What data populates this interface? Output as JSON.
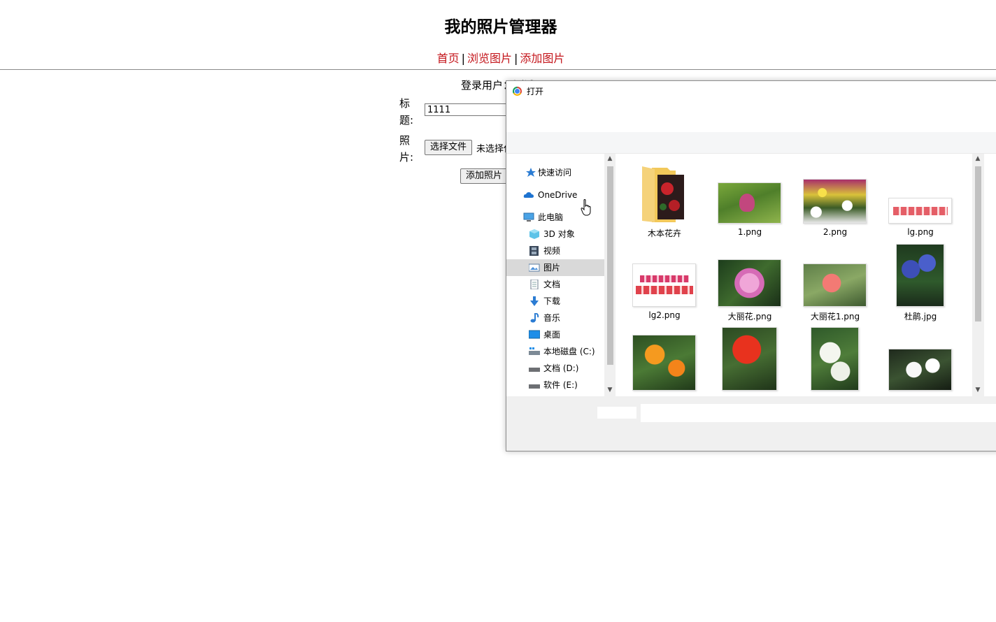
{
  "page": {
    "title": "我的照片管理器",
    "nav": {
      "home": "首页",
      "browse": "浏览图片",
      "add": "添加图片",
      "separator": "|"
    },
    "login_line": "登录用户：测试",
    "form": {
      "title_label": "标题:",
      "title_value": "1111",
      "photo_label": "照片:",
      "choose_file_button": "选择文件",
      "file_status": "未选择任何文件",
      "submit_button": "添加照片"
    }
  },
  "dialog": {
    "title": "打开",
    "nav_items": [
      {
        "label": "快速访问",
        "icon": "star-icon"
      },
      {
        "label": "OneDrive",
        "icon": "cloud-icon"
      },
      {
        "label": "此电脑",
        "icon": "computer-icon"
      },
      {
        "label": "3D 对象",
        "icon": "cube-icon"
      },
      {
        "label": "视频",
        "icon": "film-icon"
      },
      {
        "label": "图片",
        "icon": "picture-icon",
        "selected": true
      },
      {
        "label": "文档",
        "icon": "document-icon"
      },
      {
        "label": "下载",
        "icon": "download-arrow-icon"
      },
      {
        "label": "音乐",
        "icon": "music-note-icon"
      },
      {
        "label": "桌面",
        "icon": "desktop-icon"
      },
      {
        "label": "本地磁盘 (C:)",
        "icon": "drive-icon"
      },
      {
        "label": "文档 (D:)",
        "icon": "drive-icon"
      },
      {
        "label": "软件 (E:)",
        "icon": "drive-icon"
      }
    ],
    "files": [
      {
        "name": "木本花卉",
        "type": "folder"
      },
      {
        "name": "1.png",
        "type": "image"
      },
      {
        "name": "2.png",
        "type": "image"
      },
      {
        "name": "lg.png",
        "type": "image"
      },
      {
        "name": "lg2.png",
        "type": "image"
      },
      {
        "name": "大丽花.png",
        "type": "image"
      },
      {
        "name": "大丽花1.png",
        "type": "image"
      },
      {
        "name": "杜鹃.jpg",
        "type": "image"
      },
      {
        "name": "",
        "type": "image"
      },
      {
        "name": "",
        "type": "image"
      },
      {
        "name": "",
        "type": "image"
      },
      {
        "name": "",
        "type": "image"
      }
    ]
  },
  "colors": {
    "link": "#c4161c",
    "selected_nav": "#d9d9d9",
    "dialog_bottom": "#f0f0f0"
  }
}
